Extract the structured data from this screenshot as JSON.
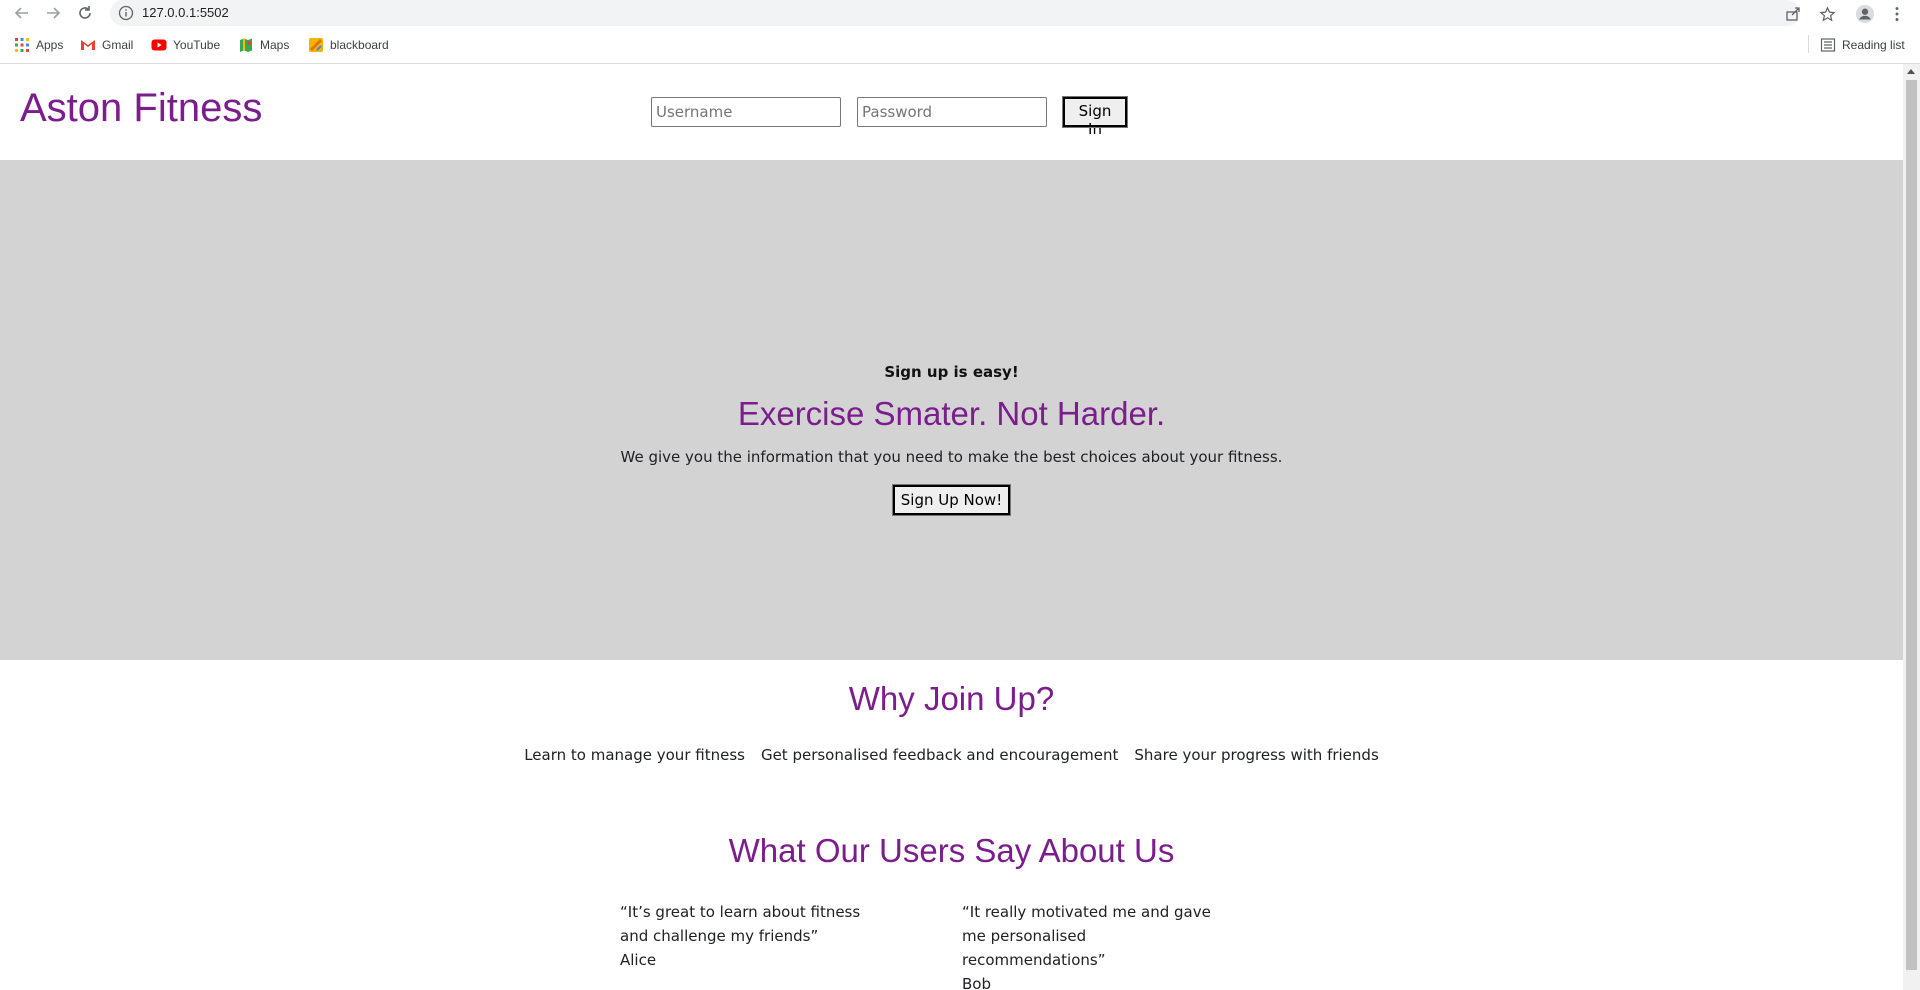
{
  "browser": {
    "url": "127.0.0.1:5502",
    "bookmarks": [
      {
        "label": "Apps",
        "icon": "apps-grid-icon"
      },
      {
        "label": "Gmail",
        "icon": "gmail-icon"
      },
      {
        "label": "YouTube",
        "icon": "youtube-icon"
      },
      {
        "label": "Maps",
        "icon": "maps-icon"
      },
      {
        "label": "blackboard",
        "icon": "blackboard-icon"
      }
    ],
    "reading_list": "Reading list"
  },
  "header": {
    "logo": "Aston Fitness",
    "username_placeholder": "Username",
    "password_placeholder": "Password",
    "sign_in_label": "Sign In"
  },
  "hero": {
    "kicker": "Sign up is easy!",
    "title": "Exercise Smater. Not Harder.",
    "text": "We give you the information that you need to make the best choices about your fitness.",
    "button": "Sign Up Now!"
  },
  "why": {
    "title": "Why Join Up?",
    "items": [
      "Learn to manage your fitness",
      "Get personalised feedback and encouragement",
      "Share your progress with friends"
    ]
  },
  "testimonials": {
    "title": "What Our Users Say About Us",
    "items": [
      {
        "quote": "“It’s great to learn about fitness and challenge my friends”",
        "author": "Alice"
      },
      {
        "quote": "“It really motivated me and gave me personalised recommendations”",
        "author": "Bob"
      }
    ]
  },
  "colors": {
    "brand": "#7b1d8c",
    "hero_bg": "#d3d3d3"
  }
}
